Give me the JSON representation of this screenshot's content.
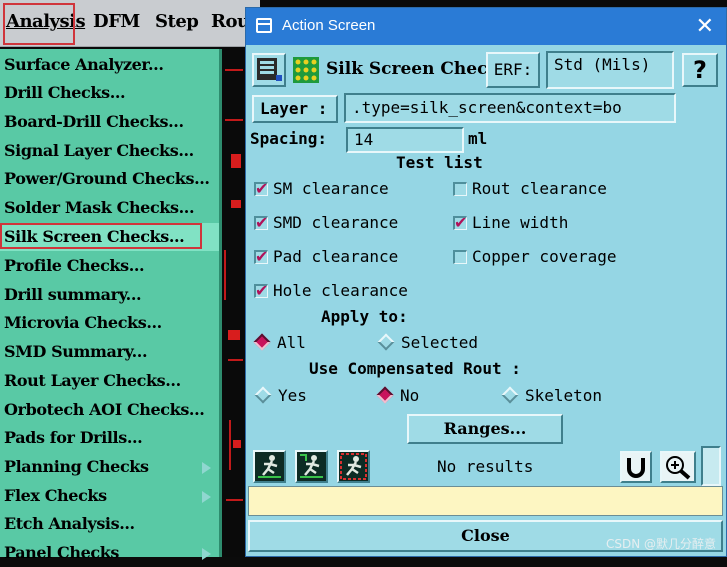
{
  "menubar": {
    "items": [
      "Analysis",
      "DFM",
      "Step",
      "Rou"
    ]
  },
  "analysis_menu": {
    "items": [
      {
        "label": "Surface Analyzer...",
        "submenu": false
      },
      {
        "label": "Drill Checks...",
        "submenu": false
      },
      {
        "label": "Board-Drill Checks...",
        "submenu": false
      },
      {
        "label": "Signal Layer Checks...",
        "submenu": false
      },
      {
        "label": "Power/Ground Checks...",
        "submenu": false
      },
      {
        "label": "Solder Mask Checks...",
        "submenu": false
      },
      {
        "label": "Silk Screen Checks...",
        "submenu": false,
        "selected": true
      },
      {
        "label": "Profile Checks...",
        "submenu": false
      },
      {
        "label": "Drill summary...",
        "submenu": false
      },
      {
        "label": "Microvia Checks...",
        "submenu": false
      },
      {
        "label": "SMD Summary...",
        "submenu": false
      },
      {
        "label": "Rout Layer Checks...",
        "submenu": false
      },
      {
        "label": "Orbotech AOI Checks...",
        "submenu": false
      },
      {
        "label": "Pads for Drills...",
        "submenu": false
      },
      {
        "label": "Planning Checks",
        "submenu": true
      },
      {
        "label": "Flex Checks",
        "submenu": true
      },
      {
        "label": "Etch Analysis...",
        "submenu": false
      },
      {
        "label": "Panel Checks",
        "submenu": true
      }
    ]
  },
  "dialog": {
    "title": "Action Screen",
    "close_glyph": "✕",
    "check_name": "Silk Screen Checks",
    "erf_label": "ERF:",
    "erf_value": "Std (Mils)",
    "help_label": "?",
    "layer_label": "Layer :",
    "layer_value": ".type=silk_screen&context=bo",
    "spacing_label": "Spacing:",
    "spacing_value": "14",
    "spacing_unit": "ml",
    "test_list_title": "Test list",
    "tests": [
      {
        "label": "SM clearance",
        "checked": true
      },
      {
        "label": "Rout clearance",
        "checked": false
      },
      {
        "label": "SMD clearance",
        "checked": true
      },
      {
        "label": "Line width",
        "checked": true
      },
      {
        "label": "Pad clearance",
        "checked": true
      },
      {
        "label": "Copper coverage",
        "checked": false
      },
      {
        "label": "Hole clearance",
        "checked": true
      }
    ],
    "apply_to_label": "Apply to:",
    "apply_options": [
      {
        "label": "All",
        "selected": true
      },
      {
        "label": "Selected",
        "selected": false
      }
    ],
    "compensated_label": "Use Compensated Rout :",
    "compensated_options": [
      {
        "label": "Yes",
        "selected": false
      },
      {
        "label": "No",
        "selected": true
      },
      {
        "label": "Skeleton",
        "selected": false
      }
    ],
    "ranges_label": "Ranges...",
    "results_text": "No results",
    "close_label": "Close"
  },
  "watermark": "CSDN @默几分醉意",
  "colors": {
    "menu_bg": "#59c9a5",
    "dialog_bg": "#95d6e4",
    "titlebar": "#2a7bd6",
    "highlight_box": "#d0353b",
    "check_mark": "#b0125a"
  }
}
